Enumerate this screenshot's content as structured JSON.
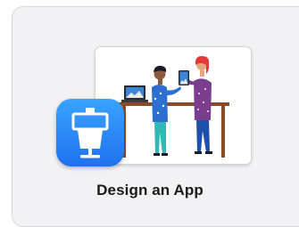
{
  "template": {
    "title": "Design an App",
    "app_icon": "keynote-podium-icon",
    "preview_image": "people-presenting-app-on-tablets-illustration"
  },
  "colors": {
    "card_background": "#f2f2f4",
    "icon_blue": "#2b8af6",
    "table_brown": "#8a4b2a"
  }
}
